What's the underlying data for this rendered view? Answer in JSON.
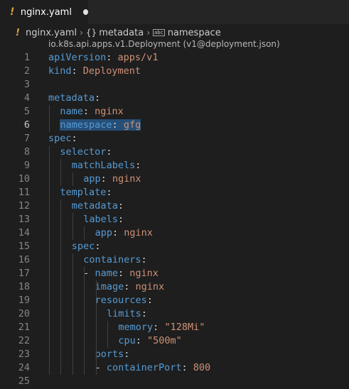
{
  "tab": {
    "title": "nginx.yaml",
    "file_icon": "yaml-exclamation-icon",
    "modified_indicator": "unsaved-dot"
  },
  "breadcrumb": {
    "file": "nginx.yaml",
    "symbol1": "metadata",
    "symbol2": "namespace"
  },
  "schema_hint": "io.k8s.api.apps.v1.Deployment (v1@deployment.json)",
  "colors": {
    "key": "#569cd6",
    "value": "#ce9178",
    "punct": "#d4d4d4",
    "selection": "#264f78"
  },
  "editor": {
    "active_line": 6,
    "lines": [
      {
        "n": "1",
        "k": "apiVersion",
        "c": ": ",
        "v": "apps/v1"
      },
      {
        "n": "2",
        "k": "kind",
        "c": ": ",
        "v": "Deployment"
      },
      {
        "n": "3",
        "k": "",
        "c": "",
        "v": ""
      },
      {
        "n": "4",
        "k": "metadata",
        "c": ":",
        "v": ""
      },
      {
        "n": "5",
        "k": "name",
        "c": ": ",
        "v": "nginx"
      },
      {
        "n": "6",
        "k": "namespace",
        "c": ": ",
        "v": "gfg"
      },
      {
        "n": "7",
        "k": "spec",
        "c": ":",
        "v": ""
      },
      {
        "n": "8",
        "k": "selector",
        "c": ":",
        "v": ""
      },
      {
        "n": "9",
        "k": "matchLabels",
        "c": ":",
        "v": ""
      },
      {
        "n": "10",
        "k": "app",
        "c": ": ",
        "v": "nginx"
      },
      {
        "n": "11",
        "k": "template",
        "c": ":",
        "v": ""
      },
      {
        "n": "12",
        "k": "metadata",
        "c": ":",
        "v": ""
      },
      {
        "n": "13",
        "k": "labels",
        "c": ":",
        "v": ""
      },
      {
        "n": "14",
        "k": "app",
        "c": ": ",
        "v": "nginx"
      },
      {
        "n": "15",
        "k": "spec",
        "c": ":",
        "v": ""
      },
      {
        "n": "16",
        "k": "containers",
        "c": ":",
        "v": ""
      },
      {
        "n": "17",
        "dash": "- ",
        "k": "name",
        "c": ": ",
        "v": "nginx"
      },
      {
        "n": "18",
        "k": "image",
        "c": ": ",
        "v": "nginx"
      },
      {
        "n": "19",
        "k": "resources",
        "c": ":",
        "v": ""
      },
      {
        "n": "20",
        "k": "limits",
        "c": ":",
        "v": ""
      },
      {
        "n": "21",
        "k": "memory",
        "c": ": ",
        "v": "\"128Mi\""
      },
      {
        "n": "22",
        "k": "cpu",
        "c": ": ",
        "v": "\"500m\""
      },
      {
        "n": "23",
        "k": "ports",
        "c": ":",
        "v": ""
      },
      {
        "n": "24",
        "dash": "- ",
        "k": "containerPort",
        "c": ": ",
        "v": "800"
      },
      {
        "n": "25",
        "k": "",
        "c": "",
        "v": ""
      }
    ]
  }
}
